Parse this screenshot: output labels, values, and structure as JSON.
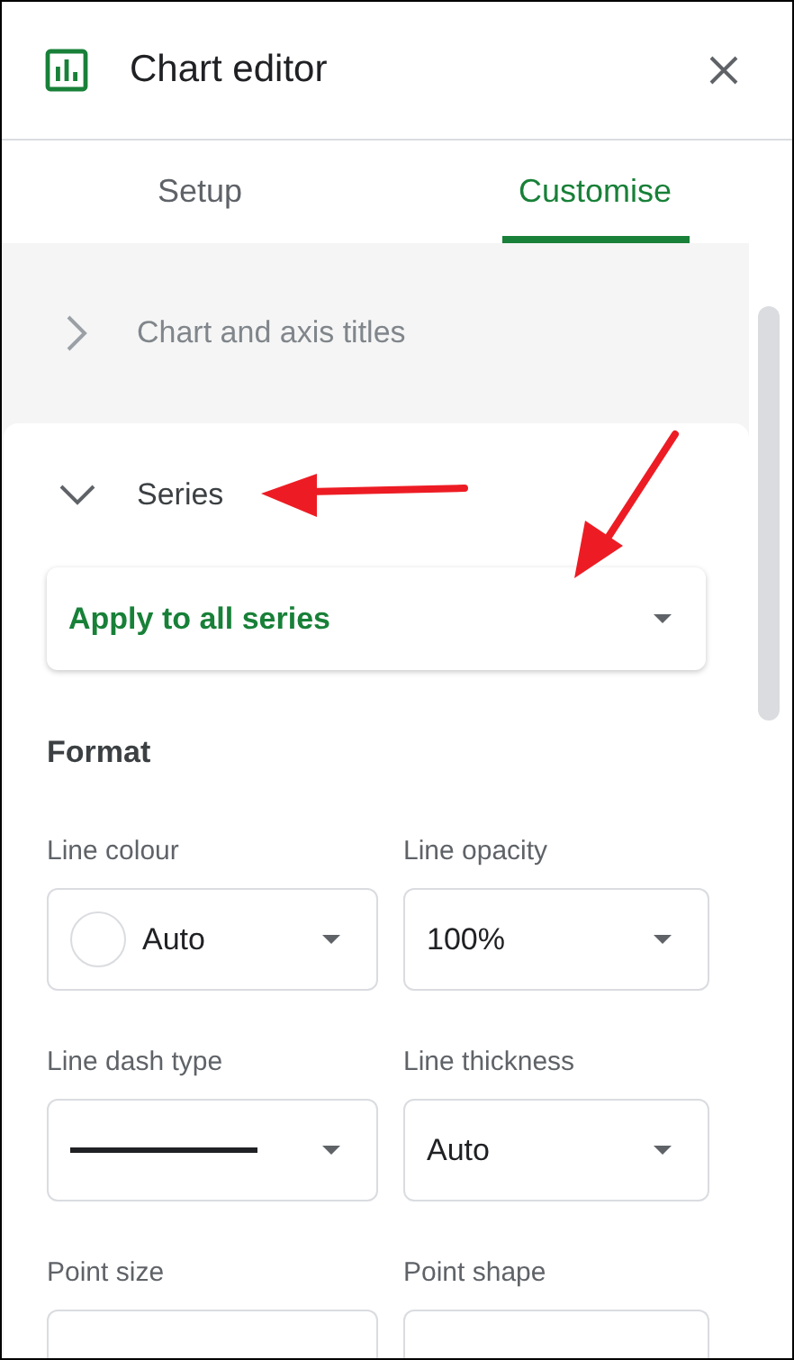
{
  "header": {
    "title": "Chart editor"
  },
  "tabs": [
    {
      "label": "Setup",
      "selected": false
    },
    {
      "label": "Customise",
      "selected": true
    }
  ],
  "sections": [
    {
      "title": "Chart and axis titles",
      "expanded": false
    },
    {
      "title": "Series",
      "expanded": true
    }
  ],
  "series_select": {
    "value": "Apply to all series"
  },
  "format": {
    "heading": "Format",
    "fields": [
      {
        "label": "Line colour",
        "kind": "color",
        "value": "Auto"
      },
      {
        "label": "Line opacity",
        "kind": "text",
        "value": "100%"
      },
      {
        "label": "Line dash type",
        "kind": "dash"
      },
      {
        "label": "Line thickness",
        "kind": "text",
        "value": "Auto"
      },
      {
        "label": "Point size",
        "kind": "empty"
      },
      {
        "label": "Point shape",
        "kind": "empty"
      }
    ]
  }
}
